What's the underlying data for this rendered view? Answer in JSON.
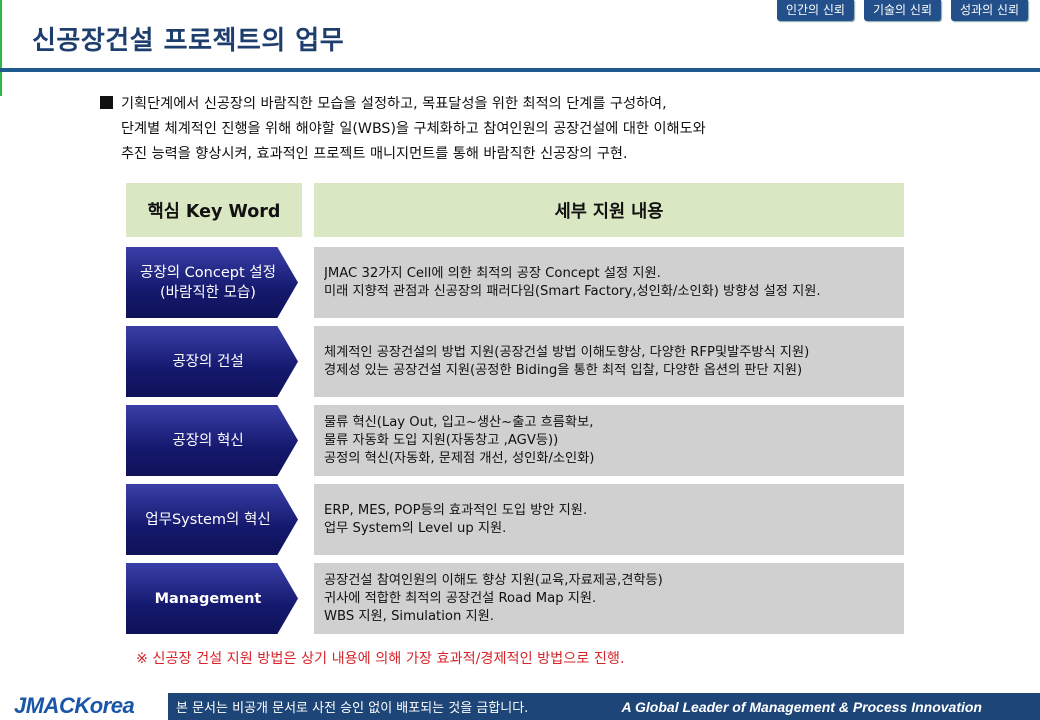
{
  "header": {
    "title": "신공장건설 프로젝트의 업무",
    "tabs": [
      "인간의 신뢰",
      "기술의 신뢰",
      "성과의 신뢰"
    ]
  },
  "intro": {
    "line1": "기획단계에서 신공장의 바람직한 모습을 설정하고, 목표달성을 위한 최적의 단계를 구성하여,",
    "line2": "단계별 체계적인 진행을 위해 해야할 일(WBS)을 구체화하고 참여인원의 공장건설에 대한 이해도와",
    "line3": "추진 능력을 향상시켜, 효과적인 프로젝트 매니지먼트를 통해 바람직한 신공장의 구현."
  },
  "table": {
    "left_header": "핵심 Key Word",
    "right_header": "세부 지원 내용",
    "rows": [
      {
        "keyword_lines": [
          "공장의 Concept 설정",
          "(바람직한 모습)"
        ],
        "details": [
          "JMAC 32가지 Cell에 의한 최적의 공장 Concept 설정 지원.",
          "미래 지향적 관점과 신공장의 패러다임(Smart Factory,성인화/소인화) 방향성 설정 지원."
        ]
      },
      {
        "keyword_lines": [
          "공장의 건설"
        ],
        "details": [
          "체계적인 공장건설의 방법 지원(공장건설 방법 이해도향상, 다양한 RFP및발주방식 지원)",
          "경제성 있는 공장건설 지원(공정한 Biding을 통한 최적 입찰, 다양한 옵션의 판단 지원)"
        ]
      },
      {
        "keyword_lines": [
          "공장의 혁신"
        ],
        "details": [
          "물류 혁신(Lay Out, 입고~생산~출고 흐름확보,",
          "물류 자동화 도입 지원(자동창고 ,AGV등))",
          "공정의 혁신(자동화, 문제점 개선, 성인화/소인화)"
        ]
      },
      {
        "keyword_lines": [
          "업무System의 혁신"
        ],
        "details": [
          "ERP, MES, POP등의 효과적인 도입 방안 지원.",
          "업무 System의 Level up 지원."
        ]
      },
      {
        "keyword_lines": [
          "Management"
        ],
        "details": [
          "공장건설 참여인원의 이해도 향상 지원(교육,자료제공,견학등)",
          "귀사에 적합한 최적의 공장건설 Road Map 지원.",
          "WBS 지원, Simulation 지원."
        ]
      }
    ]
  },
  "note": "※ 신공장 건설 지원 방법은 상기 내용에 의해 가장 효과적/경제적인 방법으로 진행.",
  "footer": {
    "logo": "JMACKorea",
    "notice": "본 문서는 비공개 문서로 사전 승인 없이 배포되는 것을 금합니다.",
    "slogan": "A Global Leader of Management & Process  Innovation"
  },
  "colors": {
    "title": "#1e3f6e",
    "header_fill": "#d9e7c3",
    "arrow_fill": "#15196e",
    "body_fill": "#d0d0d0",
    "note": "#d6262c",
    "footer_bar": "#1d4577"
  }
}
